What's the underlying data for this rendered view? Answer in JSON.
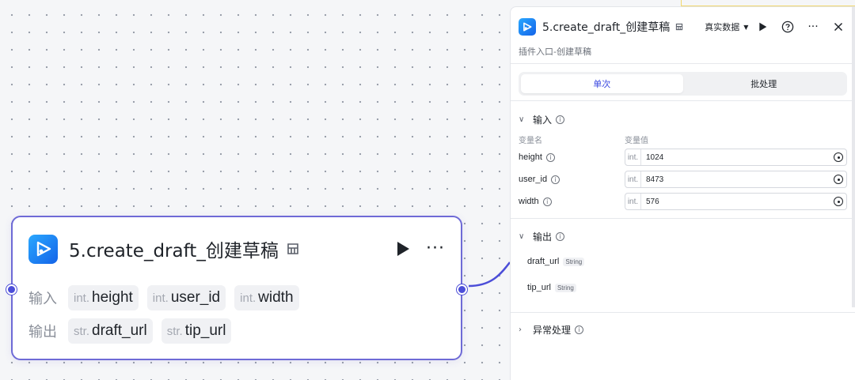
{
  "node": {
    "title": "5.create_draft_创建草稿",
    "input_label": "输入",
    "output_label": "输出",
    "inputs": [
      {
        "type": "int.",
        "name": "height"
      },
      {
        "type": "int.",
        "name": "user_id"
      },
      {
        "type": "int.",
        "name": "width"
      }
    ],
    "outputs": [
      {
        "type": "str.",
        "name": "draft_url"
      },
      {
        "type": "str.",
        "name": "tip_url"
      }
    ],
    "icons": {
      "logo": "plugin-logo-icon",
      "plugin": "plugin-cube-icon",
      "run": "play-icon",
      "more": "more-icon"
    }
  },
  "panel": {
    "title": "5.create_draft_创建草稿",
    "mode_label": "真实数据",
    "subtitle": "插件入口-创建草稿",
    "tabs": [
      {
        "label": "单次",
        "active": true
      },
      {
        "label": "批处理",
        "active": false
      }
    ],
    "input_section": {
      "title": "输入",
      "col_name": "变量名",
      "col_value": "变量值",
      "rows": [
        {
          "name": "height",
          "type": "int.",
          "value": "1024"
        },
        {
          "name": "user_id",
          "type": "int.",
          "value": "8473"
        },
        {
          "name": "width",
          "type": "int.",
          "value": "576"
        }
      ]
    },
    "output_section": {
      "title": "输出",
      "rows": [
        {
          "name": "draft_url",
          "type": "String"
        },
        {
          "name": "tip_url",
          "type": "String"
        }
      ]
    },
    "error_section": {
      "title": "异常处理"
    },
    "icons": {
      "run": "play-icon",
      "help": "help-icon",
      "more": "more-icon",
      "close": "close-icon"
    }
  },
  "colors": {
    "accent": "#3a47e0",
    "node_border": "#6e6ad6",
    "port": "#4c4ed8"
  }
}
